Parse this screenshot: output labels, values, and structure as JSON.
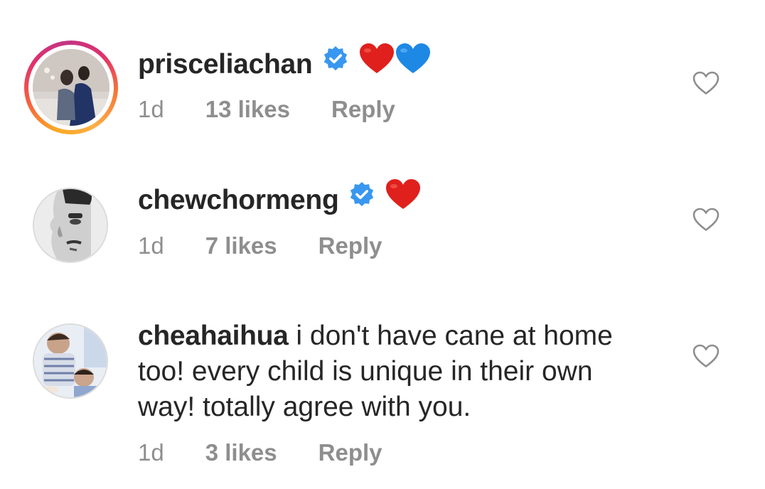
{
  "comments": [
    {
      "username": "prisceliachan",
      "verified": true,
      "text": "",
      "emojis": [
        "red-heart",
        "blue-heart"
      ],
      "time": "1d",
      "likes": "13 likes",
      "reply": "Reply",
      "has_story_ring": true
    },
    {
      "username": "chewchormeng",
      "verified": true,
      "text": "",
      "emojis": [
        "red-heart"
      ],
      "time": "1d",
      "likes": "7 likes",
      "reply": "Reply",
      "has_story_ring": false
    },
    {
      "username": "cheahaihua",
      "verified": false,
      "text_line1": "i don't have cane at home",
      "text_line2": "too! every child is unique in their own",
      "text_line3": "way! totally agree with you.",
      "time": "1d",
      "likes": "3 likes",
      "reply": "Reply",
      "has_story_ring": false
    }
  ],
  "colors": {
    "text": "#262626",
    "meta": "#8e8e8e",
    "verified": "#3897f0",
    "red_heart": "#e0201c",
    "blue_heart": "#1e88e5",
    "like_outline": "#8e8e8e"
  }
}
